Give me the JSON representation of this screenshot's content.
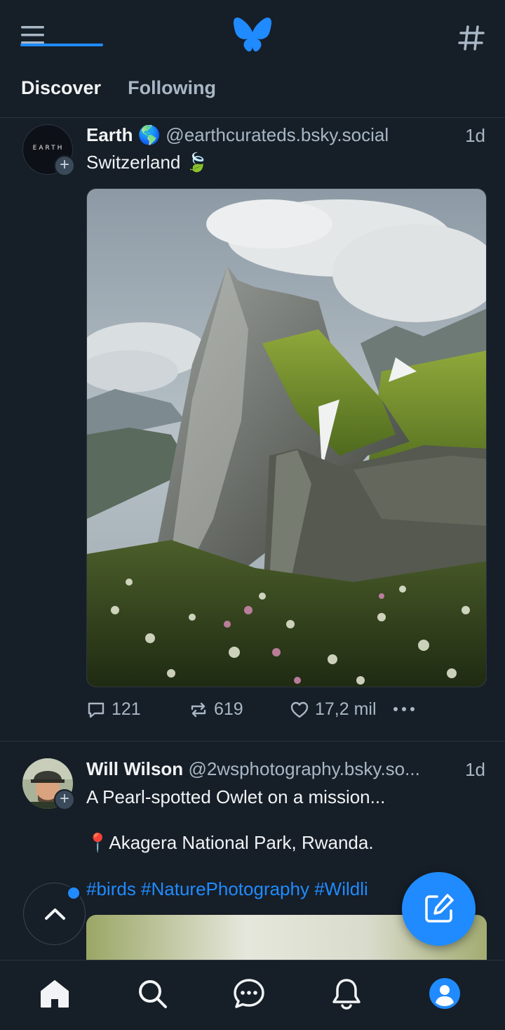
{
  "header": {
    "tabs": [
      {
        "label": "Discover",
        "active": true
      },
      {
        "label": "Following",
        "active": false
      }
    ]
  },
  "posts": [
    {
      "name": "Earth 🌎",
      "handle": "@earthcurateds.bsky.social",
      "time": "1d",
      "text": "Switzerland 🍃",
      "avatar_text": "EARTH",
      "replies": "121",
      "reposts": "619",
      "likes": "17,2 mil"
    },
    {
      "name": "Will Wilson",
      "handle": "@2wsphotography.bsky.so...",
      "time": "1d",
      "text": "A Pearl-spotted Owlet on a mission...",
      "location": "📍Akagera National Park, Rwanda.",
      "hashtags": "#birds #NaturePhotography #Wildli"
    }
  ],
  "colors": {
    "background": "#161e27",
    "accent": "#208bfe",
    "muted_text": "#a8b7c5",
    "divider": "#2a3440"
  },
  "icons": {
    "header": [
      "menu-icon",
      "butterfly-logo-icon",
      "hashtag-icon"
    ],
    "actions": [
      "reply-icon",
      "repost-icon",
      "like-icon",
      "more-icon"
    ],
    "floating": [
      "chevron-up-icon",
      "compose-icon"
    ],
    "bottom_nav": [
      "home-icon",
      "search-icon",
      "chat-icon",
      "bell-icon",
      "profile-icon"
    ]
  }
}
